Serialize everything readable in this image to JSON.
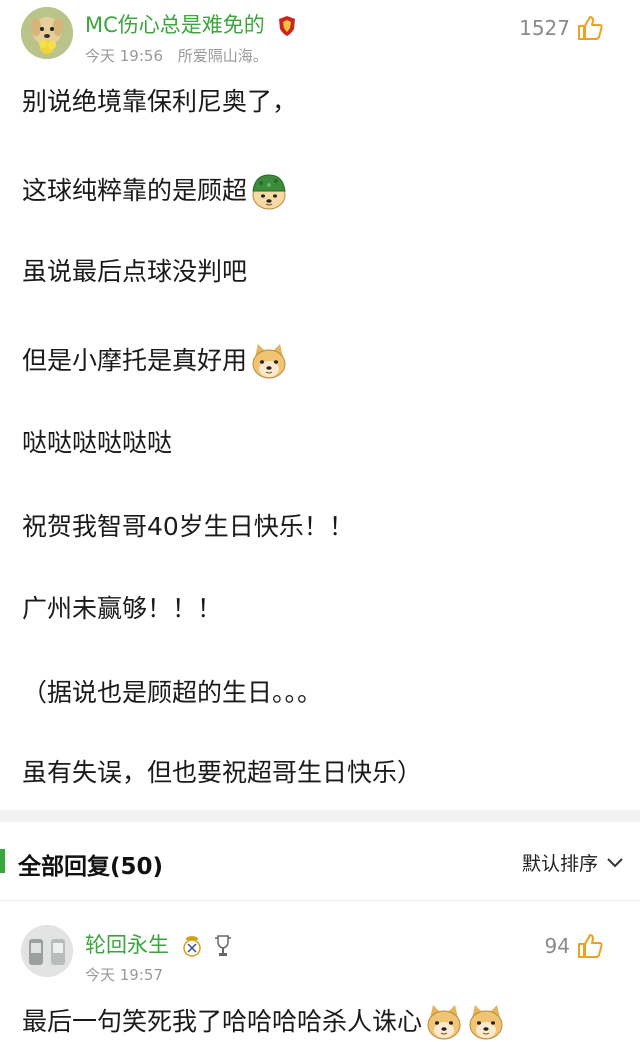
{
  "post": {
    "username": "MC伤心总是难免的",
    "time": "今天 19:56",
    "location": "所爱隔山海。",
    "likes": "1527",
    "lines": [
      "别说绝境靠保利尼奥了，",
      "这球纯粹靠的是顾超",
      "虽说最后点球没判吧",
      "但是小摩托是真好用",
      "哒哒哒哒哒哒",
      "祝贺我智哥40岁生日快乐！！",
      "广州未赢够！！！",
      "（据说也是顾超的生日。。。",
      "虽有失误，但也要祝超哥生日快乐）"
    ]
  },
  "replies_section": {
    "title": "全部回复(50)",
    "sort_label": "默认排序"
  },
  "reply": {
    "username": "轮回永生",
    "time": "今天 19:57",
    "likes": "94",
    "text": "最后一句笑死我了哈哈哈哈杀人诛心"
  },
  "colors": {
    "accent": "#3aa63d",
    "meta": "#9a9a9a",
    "like_icon": "#f0a020"
  }
}
